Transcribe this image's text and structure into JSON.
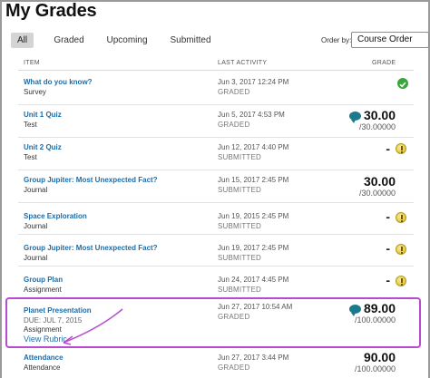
{
  "page": {
    "title": "My Grades"
  },
  "tabs": [
    {
      "label": "All",
      "active": true
    },
    {
      "label": "Graded",
      "active": false
    },
    {
      "label": "Upcoming",
      "active": false
    },
    {
      "label": "Submitted",
      "active": false
    }
  ],
  "order": {
    "label": "Order by:",
    "value": "Course Order"
  },
  "columns": {
    "item": "ITEM",
    "activity": "LAST ACTIVITY",
    "grade": "GRADE"
  },
  "rows": [
    {
      "title": "What do you know?",
      "type": "Survey",
      "date": "Jun 3, 2017 12:24 PM",
      "status": "GRADED",
      "grade_icon": "check-icon"
    },
    {
      "title": "Unit 1 Quiz",
      "type": "Test",
      "date": "Jun 5, 2017  4:53 PM",
      "status": "GRADED",
      "score": "30.00",
      "total": "/30.00000",
      "comment": true
    },
    {
      "title": "Unit 2 Quiz",
      "type": "Test",
      "date": "Jun 12, 2017 4:40 PM",
      "status": "SUBMITTED",
      "dash": "-",
      "grade_icon": "warning-icon"
    },
    {
      "title": "Group Jupiter: Most Unexpected Fact?",
      "type": "Journal",
      "date": "Jun 15, 2017 2:45 PM",
      "status": "SUBMITTED",
      "score": "30.00",
      "total": "/30.00000"
    },
    {
      "title": "Space Exploration",
      "type": "Journal",
      "date": "Jun 19, 2015 2:45 PM",
      "status": "SUBMITTED",
      "dash": "-",
      "grade_icon": "warning-icon"
    },
    {
      "title": "Group Jupiter: Most Unexpected Fact?",
      "type": "Journal",
      "date": "Jun 19, 2017 2:45 PM",
      "status": "SUBMITTED",
      "dash": "-",
      "grade_icon": "warning-icon"
    },
    {
      "title": "Group Plan",
      "type": "Assignment",
      "date": "Jun 24, 2017 4:45 PM",
      "status": "SUBMITTED",
      "dash": "-",
      "grade_icon": "warning-icon"
    },
    {
      "title": "Planet Presentation",
      "due": "DUE: JUL 7, 2015",
      "type": "Assignment",
      "rubric": "View Rubric",
      "date": "Jun 27, 2017 10:54 AM",
      "status": "GRADED",
      "score": "89.00",
      "total": "/100.00000",
      "comment": true
    },
    {
      "title": "Attendance",
      "type": "Attendance",
      "date": "Jun 27, 2017  3:44 PM",
      "status": "GRADED",
      "score": "90.00",
      "total": "/100.00000"
    }
  ],
  "colors": {
    "link": "#1d6ca8",
    "highlight": "#b94bd1",
    "comment": "#1b7b8c",
    "check": "#3aa53a"
  }
}
